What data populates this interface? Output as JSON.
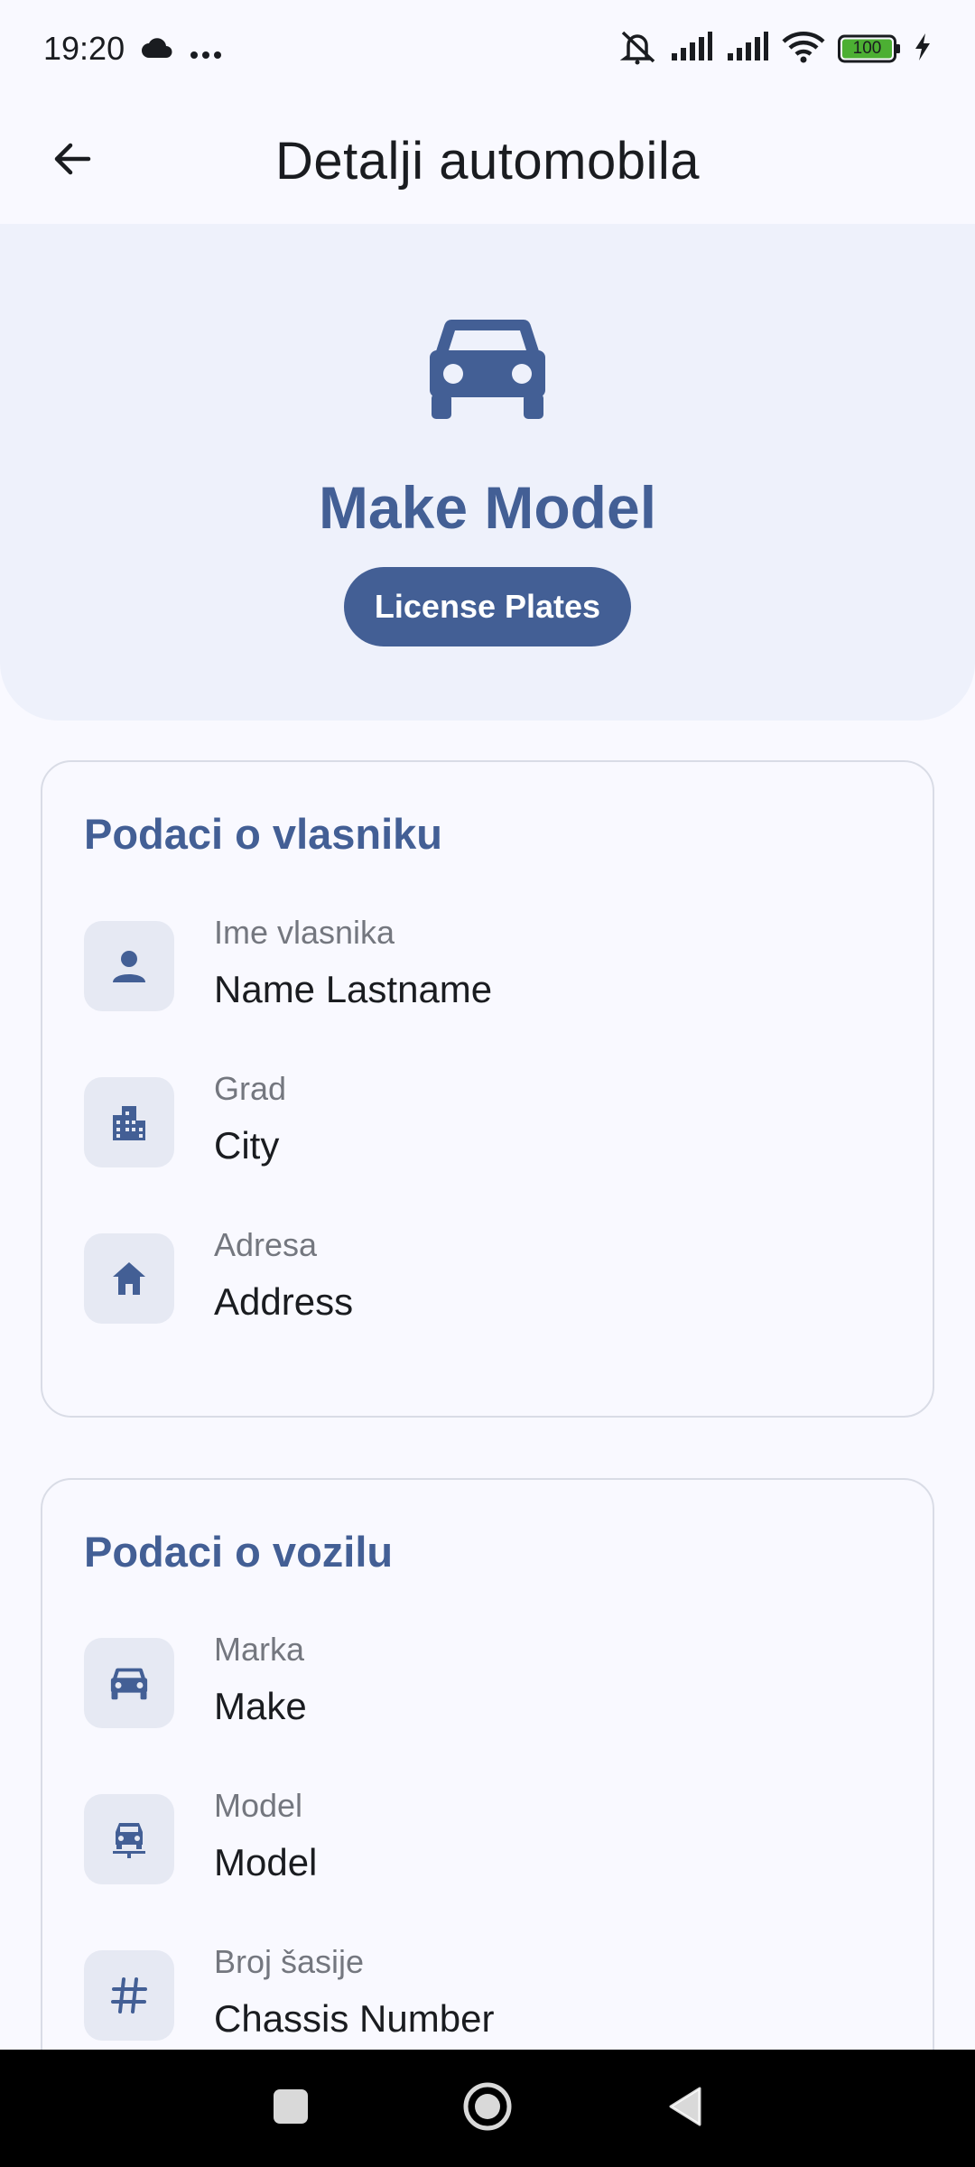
{
  "status_bar": {
    "time": "19:20",
    "battery": "100",
    "icons": [
      "cloud-icon",
      "more-dots-icon",
      "mute-icon",
      "signal-icon",
      "signal-icon",
      "wifi-icon",
      "battery-icon",
      "charging-icon"
    ]
  },
  "app_bar": {
    "title": "Detalji automobila",
    "back_icon": "arrow-back-icon"
  },
  "hero": {
    "icon": "car-icon",
    "title": "Make Model",
    "plates": "License Plates"
  },
  "owner_card": {
    "title": "Podaci o vlasniku",
    "rows": [
      {
        "icon": "person-icon",
        "label": "Ime vlasnika",
        "value": "Name Lastname"
      },
      {
        "icon": "city-icon",
        "label": "Grad",
        "value": "City"
      },
      {
        "icon": "home-icon",
        "label": "Adresa",
        "value": "Address"
      }
    ]
  },
  "vehicle_card": {
    "title": "Podaci o vozilu",
    "rows": [
      {
        "icon": "car-icon",
        "label": "Marka",
        "value": "Make"
      },
      {
        "icon": "car-model-icon",
        "label": "Model",
        "value": "Model"
      },
      {
        "icon": "hash-icon",
        "label": "Broj šasije",
        "value": "Chassis Number"
      }
    ]
  },
  "nav_bar": {
    "icons": [
      "recents-icon",
      "home-icon",
      "back-icon"
    ]
  },
  "colors": {
    "accent": "#435f95",
    "hero_bg": "#eef1fb",
    "icon_tile": "#e6e9f3",
    "background": "#f9f9ff"
  }
}
